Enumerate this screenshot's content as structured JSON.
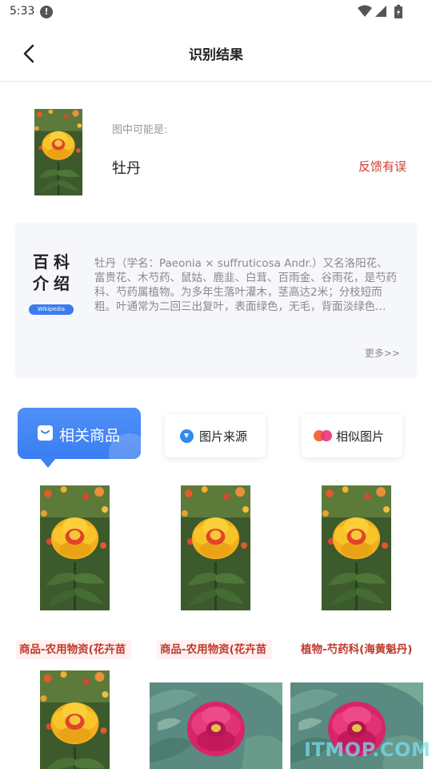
{
  "status_bar": {
    "time": "5:33",
    "alert_glyph": "!"
  },
  "header": {
    "title": "识别结果"
  },
  "result": {
    "hint": "图中可能是:",
    "name": "牡丹",
    "feedback_label": "反馈有误"
  },
  "encyclopedia": {
    "title": "百科介绍",
    "badge": "Wikipedia",
    "text": "牡丹（学名：Paeonia × suffruticosa Andr.）又名洛阳花、富贵花、木芍药、鼠姑、鹿韭、白茸、百雨金、谷雨花，是芍药科、芍药属植物。为多年生落叶灌木，茎高达2米；分枝短而粗。叶通常为二回三出复叶，表面绿色，无毛，背面淡绿色…",
    "more_label": "更多>>"
  },
  "tabs": [
    {
      "label": "相关商品",
      "icon": "shopping-bag-icon",
      "active": true
    },
    {
      "label": "图片来源",
      "icon": "download-icon",
      "active": false
    },
    {
      "label": "相似图片",
      "icon": "similar-circles-icon",
      "active": false
    }
  ],
  "grid": {
    "captions": [
      "商品-农用物资(花卉苗",
      "商品-农用物资(花卉苗",
      "植物-芍药科(海黄魁丹)"
    ]
  },
  "colors": {
    "accent_blue": "#3a7ef2",
    "feedback_red": "#d23c2e",
    "caption_red": "#c0392b"
  },
  "watermark": "ITMOP.COM"
}
